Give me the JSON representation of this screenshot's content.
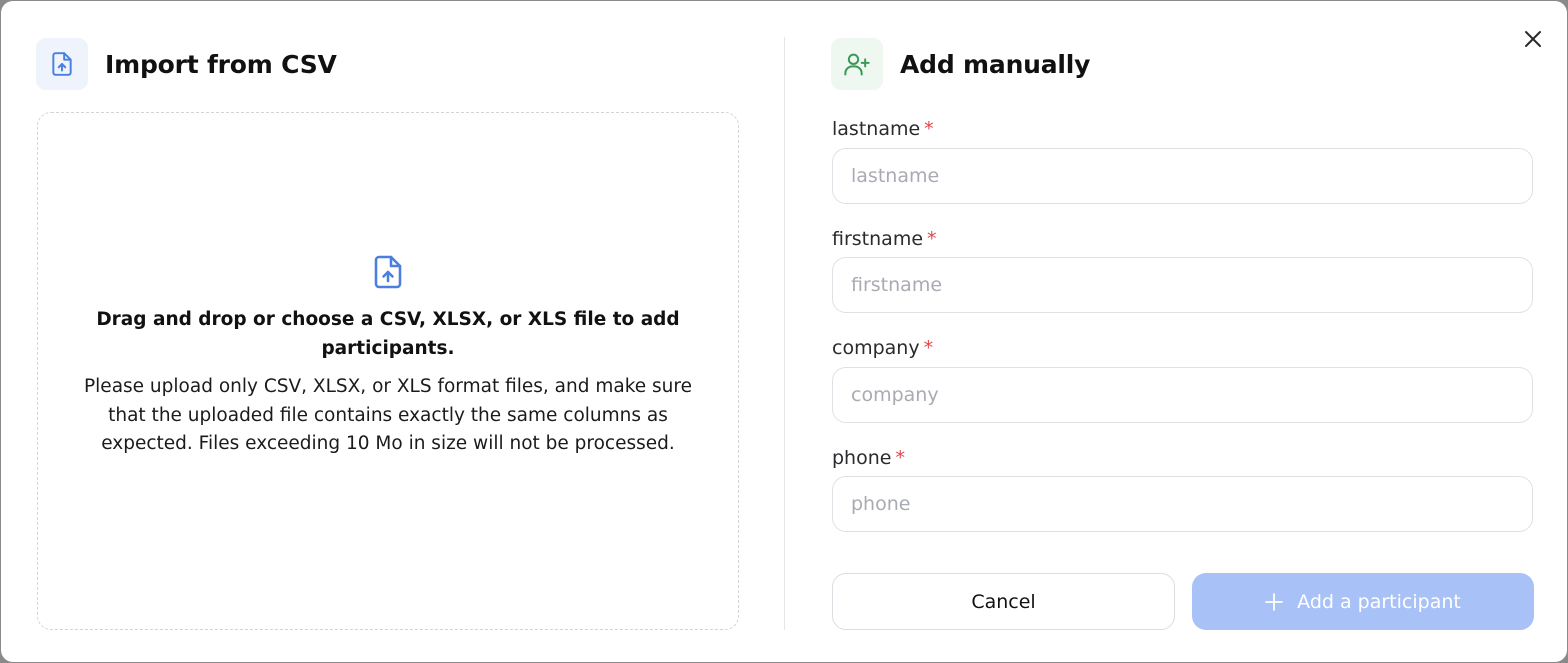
{
  "import_section": {
    "title": "Import from CSV",
    "drop_title": "Drag and drop or choose a CSV, XLSX, or XLS file to add participants.",
    "drop_description": "Please upload only CSV, XLSX, or XLS format files, and make sure that the uploaded file contains exactly the same columns as expected. Files exceeding 10 Mo in size will not be processed."
  },
  "manual_section": {
    "title": "Add manually",
    "fields": [
      {
        "label": "lastname",
        "required_mark": "*",
        "placeholder": "lastname",
        "value": ""
      },
      {
        "label": "firstname",
        "required_mark": "*",
        "placeholder": "firstname",
        "value": ""
      },
      {
        "label": "company",
        "required_mark": "*",
        "placeholder": "company",
        "value": ""
      },
      {
        "label": "phone",
        "required_mark": "*",
        "placeholder": "phone",
        "value": ""
      }
    ],
    "cancel_label": "Cancel",
    "add_label": "Add a participant"
  },
  "icons": {
    "close": "close-icon",
    "file_upload": "file-upload-icon",
    "user_add": "user-plus-icon",
    "plus": "plus-icon"
  },
  "colors": {
    "accent_blue": "#4a7fe0",
    "accent_green": "#3a9a55",
    "required": "#e0474c",
    "add_button_disabled": "#a8c1f7"
  }
}
